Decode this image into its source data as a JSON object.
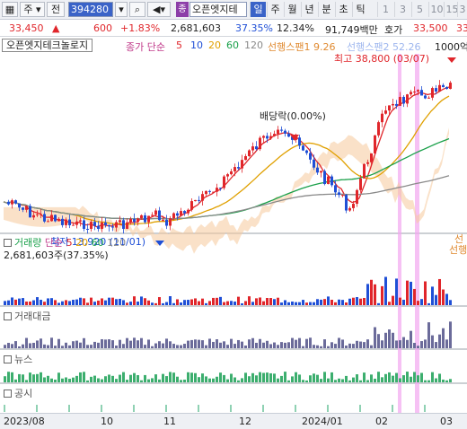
{
  "toolbar": {
    "market": "주",
    "period_type": "전",
    "code": "394280",
    "badge": "종",
    "stock_name": "오픈엣지테",
    "tabs": [
      "일",
      "주",
      "월",
      "년",
      "분",
      "초",
      "틱"
    ],
    "active_tab": "일",
    "numbers": [
      "1",
      "3",
      "5",
      "10",
      "15",
      "3"
    ]
  },
  "quote": {
    "price": "33,450",
    "arrow": "▲",
    "change": "600",
    "change_pct": "+1.83%",
    "volume": "2,681,603",
    "vol_ratio": "37.35%",
    "turnover": "12.34%",
    "amount": "91,749백만",
    "ask_label": "호가",
    "ask_price": "33,500",
    "bid_price": "33"
  },
  "main_chart": {
    "name": "오픈엣지테크놀로지",
    "legend_prefix": "종가 단순",
    "ma": [
      "5",
      "10",
      "20",
      "60",
      "120"
    ],
    "ma_colors": [
      "#e0262b",
      "#1f4fd6",
      "#e0a000",
      "#1aa04a",
      "#8a8a8a"
    ],
    "ichimoku_label": "선행스팬1",
    "ichimoku_val1": "9.26",
    "ichimoku_label2": "선행스팬2",
    "ichimoku_val2": "52.26",
    "unit": "1000억",
    "ann_high": "최고 38,800 (03/07)",
    "ann_low": "최저 13,920 (11/01)",
    "ann_div": "배당락(0.00%)",
    "side_label1": "선",
    "side_label2": "선행"
  },
  "volume_panel": {
    "title": "거래량",
    "legend_prefix": "단순",
    "ma": [
      "5",
      "20",
      "60",
      "120"
    ],
    "value": "2,681,603주(37.35%)"
  },
  "amount_panel": {
    "title": "거래대금"
  },
  "news_panel": {
    "title": "뉴스"
  },
  "disclosure_panel": {
    "title": "공시"
  },
  "x_axis": [
    "2023/08",
    "10",
    "11",
    "12",
    "2024/01",
    "02",
    "03"
  ],
  "colors": {
    "up": "#e0262b",
    "down": "#1f4fd6",
    "cloud_up": "#f6c89a",
    "cloud_down": "#9db6ee",
    "highlight": "#f2a6ef"
  }
}
